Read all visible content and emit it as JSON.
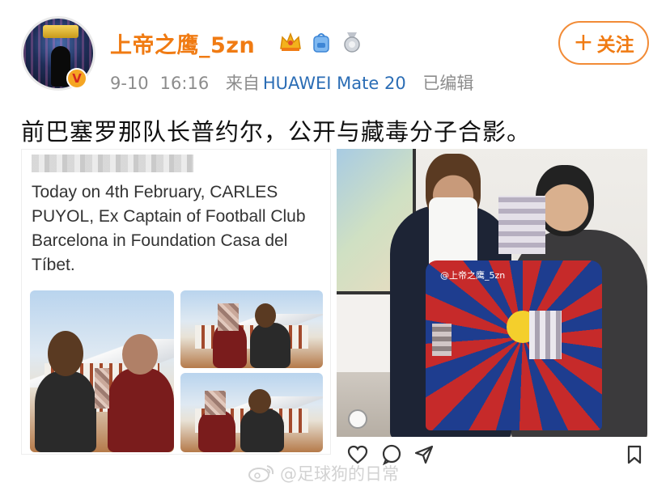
{
  "post": {
    "author": {
      "username": "上帝之鹰_5zn"
    },
    "meta": {
      "date": "9-10",
      "time": "16:16",
      "via": "来自",
      "device": "HUAWEI Mate 20",
      "edited": "已编辑"
    },
    "follow_label": "关注",
    "follow_plus": "+",
    "text": "前巴塞罗那队长普约尔，公开与藏毒分子合影。",
    "left_image": {
      "caption": "Today on 4th February, CARLES PUYOL, Ex Captain of Football Club Barcelona in Foundation Casa del Tíbet."
    },
    "right_image": {
      "jersey_watermark": "@上帝之鹰_5zn"
    },
    "actions": [
      "like-icon",
      "comment-icon",
      "share-icon",
      "bookmark-icon"
    ]
  },
  "watermark": {
    "text": "@足球狗的日常"
  },
  "colors": {
    "username": "#f07b13",
    "device_link": "#2b6db5",
    "meta": "#8c8c8c",
    "follow_border": "#f28b36"
  }
}
